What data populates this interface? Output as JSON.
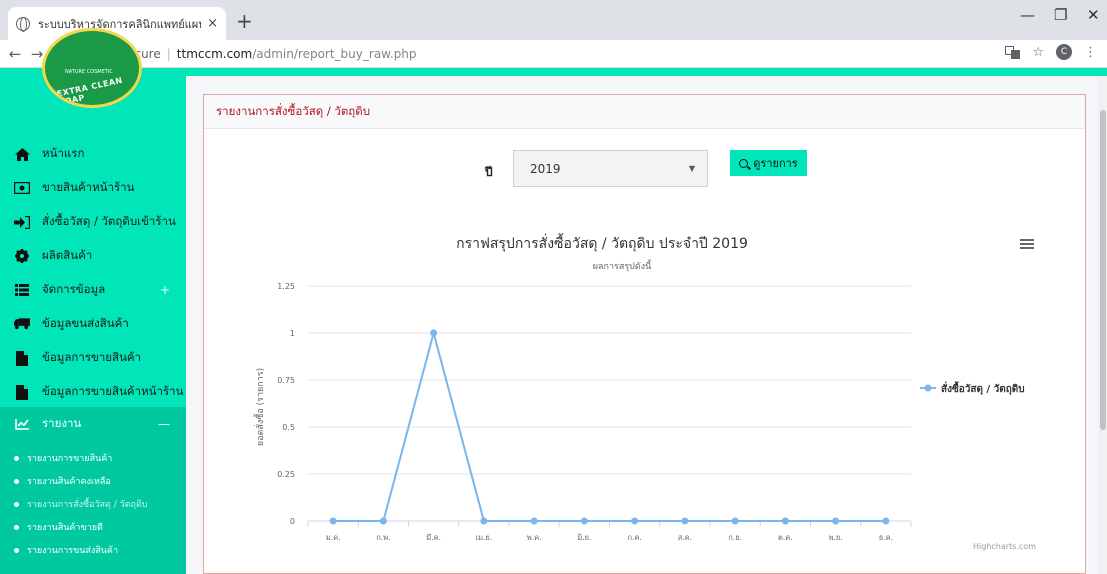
{
  "browser": {
    "tab_title": "ระบบบริหารจัดการคลินิกแพทย์แผนไทย",
    "tab_close": "×",
    "new_tab": "+",
    "back": "←",
    "forward": "→",
    "reload": "C",
    "not_secure": "Not secure",
    "url_host": "ttmccm.com",
    "url_path": "/admin/report_buy_raw.php",
    "minimize": "—",
    "restore": "❐",
    "close": "✕",
    "translate_icon": "translate-icon",
    "star": "☆",
    "profile": "C",
    "menu": "⋮"
  },
  "logo": {
    "top_text": "NATURE COSMETIC",
    "arc_text": "EXTRA CLEAN SOAP"
  },
  "sidebar": {
    "items": [
      {
        "label": "หน้าแรก",
        "icon": "home-icon"
      },
      {
        "label": "ขายสินค้าหน้าร้าน",
        "icon": "cash-icon"
      },
      {
        "label": "สั่งซื้อวัสดุ / วัตถุดิบเข้าร้าน",
        "icon": "sign-in-icon"
      },
      {
        "label": "ผลิตสินค้า",
        "icon": "gear-icon"
      },
      {
        "label": "จัดการข้อมูล",
        "icon": "list-icon",
        "expand": "+"
      },
      {
        "label": "ข้อมูลขนส่งสินค้า",
        "icon": "truck-icon"
      },
      {
        "label": "ข้อมูลการขายสินค้า",
        "icon": "document-icon"
      },
      {
        "label": "ข้อมูลการขายสินค้าหน้าร้าน",
        "icon": "document-icon"
      },
      {
        "label": "รายงาน",
        "icon": "chart-line-icon",
        "collapse": "—"
      }
    ],
    "report_submenu": [
      {
        "label": "รายงานการขายสินค้า"
      },
      {
        "label": "รายงานสินค้าคงเหลือ"
      },
      {
        "label": "รายงานการสั่งซื้อวัสดุ / วัตถุดิบ"
      },
      {
        "label": "รายงานสินค้าขายดี"
      },
      {
        "label": "รายงานการขนส่งสินค้า"
      }
    ]
  },
  "panel": {
    "title": "รายงานการสั่งซื้อวัสดุ / วัตถุดิบ",
    "filter_label": "ปี",
    "year_value": "2019",
    "search_label": "ดูรายการ"
  },
  "chart_data": {
    "type": "line",
    "title": "กราฟสรุปการสั่งซื้อวัสดุ / วัตถุดิบ ประจำปี 2019",
    "subtitle": "ผลการสรุปดังนี้",
    "ylabel": "ยอดสั่งซื้อ (รายการ)",
    "xlabel": "",
    "categories": [
      "ม.ค.",
      "ก.พ.",
      "มี.ค.",
      "เม.ย.",
      "พ.ค.",
      "มิ.ย.",
      "ก.ค.",
      "ส.ค.",
      "ก.ย.",
      "ต.ค.",
      "พ.ย.",
      "ธ.ค."
    ],
    "series": [
      {
        "name": "สั่งซื้อวัสดุ / วัตถุดิบ",
        "values": [
          0,
          0,
          1,
          0,
          0,
          0,
          0,
          0,
          0,
          0,
          0,
          0
        ],
        "color": "#7cb5ec"
      }
    ],
    "yticks": [
      "0",
      "0.25",
      "0.5",
      "0.75",
      "1",
      "1.25"
    ],
    "ylim": [
      0,
      1.25
    ],
    "grid": true,
    "legend_position": "right",
    "credits": "Highcharts.com"
  }
}
